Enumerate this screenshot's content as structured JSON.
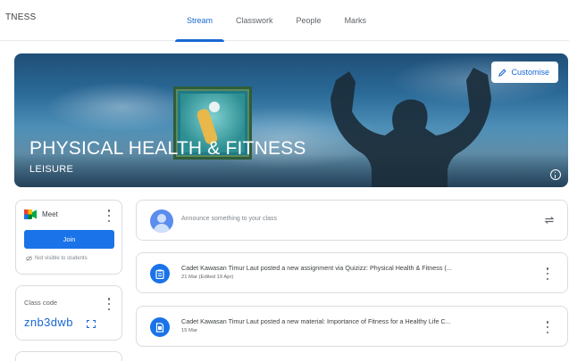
{
  "header": {
    "brand": "TNESS",
    "tabs": [
      {
        "label": "Stream",
        "active": true
      },
      {
        "label": "Classwork",
        "active": false
      },
      {
        "label": "People",
        "active": false
      },
      {
        "label": "Marks",
        "active": false
      }
    ]
  },
  "banner": {
    "title": "PHYSICAL HEALTH & FITNESS",
    "subtitle": "LEISURE",
    "customise_label": "Customise",
    "customise_icon": "pencil-icon",
    "info_icon": "info-icon"
  },
  "meet": {
    "label": "Meet",
    "icon": "meet-logo-icon",
    "join_label": "Join",
    "visibility_note": "Not visible to students"
  },
  "class_code": {
    "label": "Class code",
    "value": "znb3dwb",
    "fullscreen_icon": "fullscreen-icon"
  },
  "announce": {
    "placeholder": "Announce something to your class",
    "repost_icon": "repost-icon"
  },
  "posts": [
    {
      "icon": "assignment-icon",
      "title": "Cadet Kawasan Timur Laut posted a new assignment via Quizizz: Physical Health & Fitness (...",
      "date": "21 Mar (Edited 19 Apr)"
    },
    {
      "icon": "material-icon",
      "title": "Cadet Kawasan Timur Laut posted a new material: Importance of Fitness for a Healthy Life C...",
      "date": "15 Mar"
    }
  ],
  "colors": {
    "accent": "#1967d2",
    "join_button": "#1a73e8"
  }
}
